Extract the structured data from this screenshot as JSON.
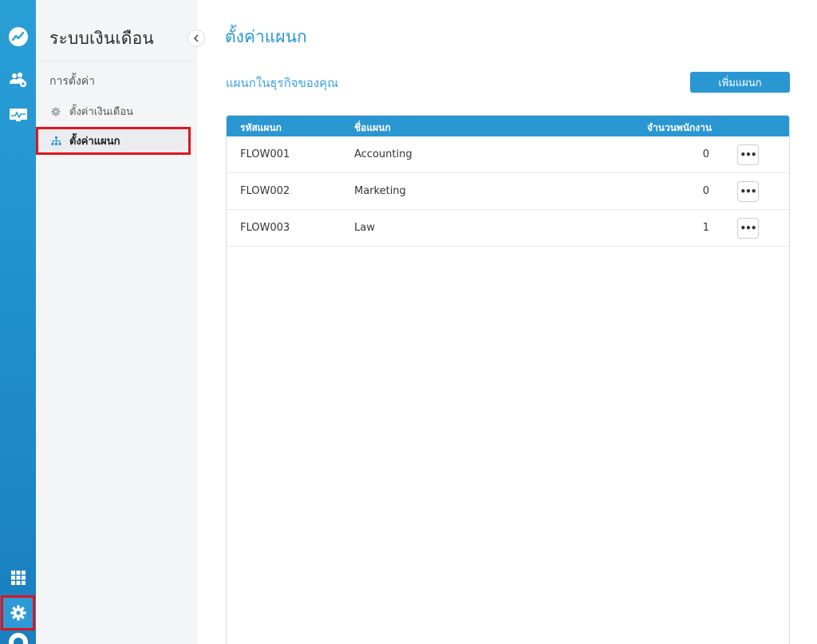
{
  "rail": {
    "icons": [
      "analytics-logo-icon",
      "team-settings-icon",
      "monitor-chart-icon",
      "apps-grid-icon",
      "gear-icon",
      "help-icon"
    ]
  },
  "sidebar": {
    "title": "ระบบเงินเดือน",
    "section_label": "การตั้งค่า",
    "items": [
      {
        "label": "ตั้งค่าเงินเดือน",
        "icon": "gear-icon"
      },
      {
        "label": "ตั้งค่าแผนก",
        "icon": "org-chart-icon"
      }
    ]
  },
  "main": {
    "title": "ตั้งค่าแผนก",
    "subtitle": "แผนกในธุรกิจของคุณ",
    "add_button": "เพิ่มแผนก",
    "table": {
      "headers": [
        "รหัสแผนก",
        "ชื่อแผนก",
        "จำนวนพนักงาน"
      ],
      "rows": [
        {
          "code": "FLOW001",
          "name": "Accounting",
          "count": "0"
        },
        {
          "code": "FLOW002",
          "name": "Marketing",
          "count": "0"
        },
        {
          "code": "FLOW003",
          "name": "Law",
          "count": "1"
        }
      ],
      "more_label": "•••"
    }
  },
  "colors": {
    "accent": "#2a97d3",
    "highlight_border": "#e0141b"
  }
}
